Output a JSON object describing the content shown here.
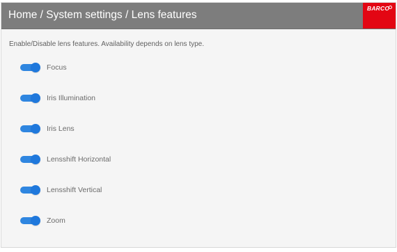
{
  "header": {
    "breadcrumb": "Home / System settings / Lens features",
    "logo_text": "BARCO",
    "header_bg": "#7d7d7d",
    "logo_bg": "#e30613"
  },
  "main": {
    "description": "Enable/Disable lens features. Availability depends on lens type.",
    "features": [
      {
        "label": "Focus",
        "enabled": true
      },
      {
        "label": "Iris Illumination",
        "enabled": true
      },
      {
        "label": "Iris Lens",
        "enabled": true
      },
      {
        "label": "Lensshift Horizontal",
        "enabled": true
      },
      {
        "label": "Lensshift Vertical",
        "enabled": true
      },
      {
        "label": "Zoom",
        "enabled": true
      }
    ],
    "toggle_on_color": "#2f86e0"
  }
}
